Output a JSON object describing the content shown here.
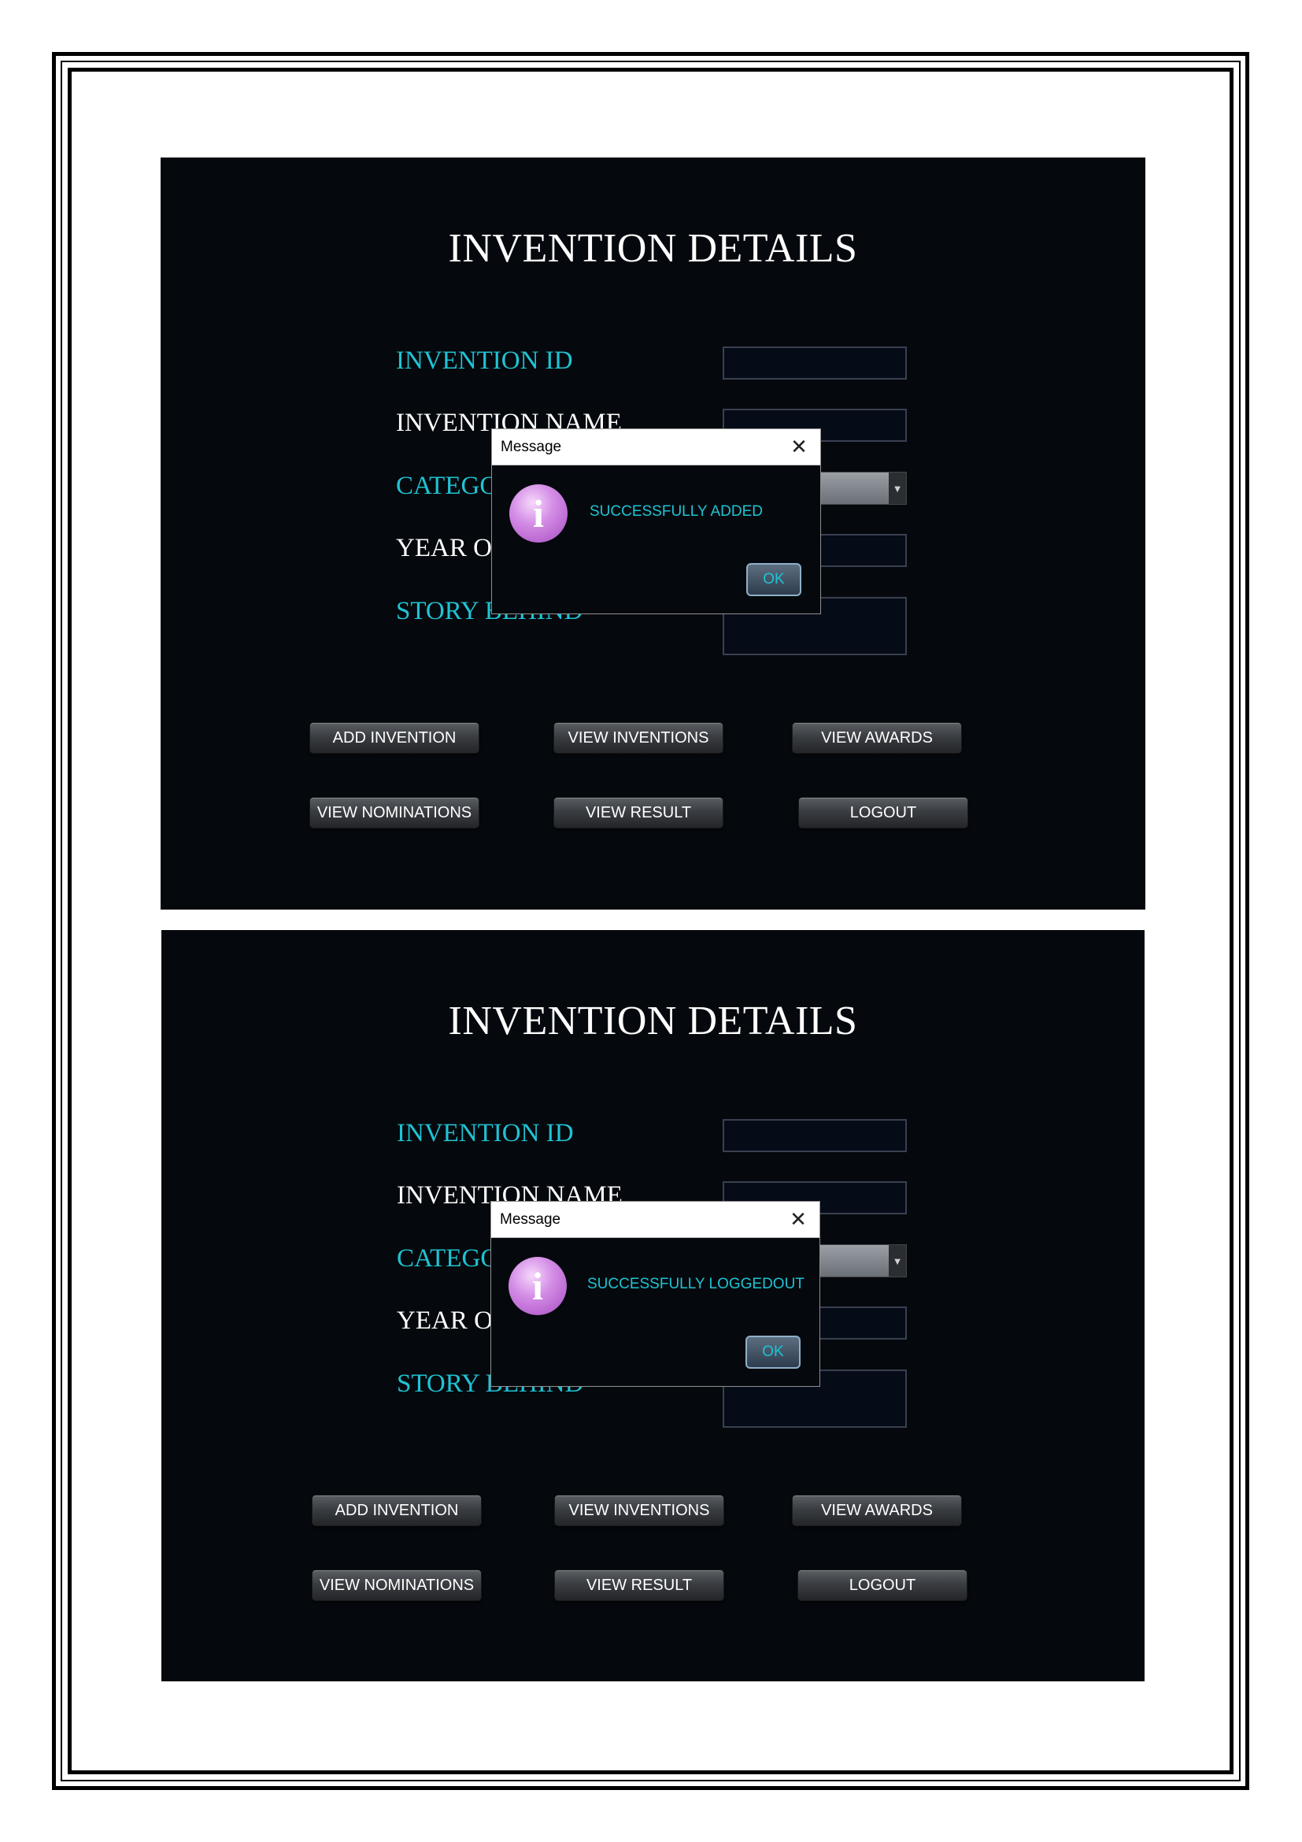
{
  "screens": [
    {
      "title": "INVENTION DETAILS",
      "labels": {
        "invention_id": "INVENTION ID",
        "invention_name": "INVENTION NAME",
        "category": "CATEGORY",
        "year": "YEAR OF",
        "story": "STORY BEHIND"
      },
      "buttons": {
        "add_invention": "ADD INVENTION",
        "view_inventions": "VIEW INVENTIONS",
        "view_awards": "VIEW AWARDS",
        "view_nominations": "VIEW NOMINATIONS",
        "view_result": "VIEW RESULT",
        "logout": "LOGOUT"
      },
      "dialog": {
        "title": "Message",
        "close_icon": "close-icon",
        "info_icon": "information-icon",
        "message": "SUCCESSFULLY ADDED",
        "ok_label": "OK"
      }
    },
    {
      "title": "INVENTION DETAILS",
      "labels": {
        "invention_id": "INVENTION ID",
        "invention_name": "INVENTION NAME",
        "category": "CATEGORY",
        "year": "YEAR OF",
        "story": "STORY BEHIND"
      },
      "buttons": {
        "add_invention": "ADD INVENTION",
        "view_inventions": "VIEW INVENTIONS",
        "view_awards": "VIEW AWARDS",
        "view_nominations": "VIEW NOMINATIONS",
        "view_result": "VIEW RESULT",
        "logout": "LOGOUT"
      },
      "dialog": {
        "title": "Message",
        "close_icon": "close-icon",
        "info_icon": "information-icon",
        "message": "SUCCESSFULLY LOGGEDOUT",
        "ok_label": "OK"
      }
    }
  ],
  "colors": {
    "background": "#05090d",
    "label_cyan": "#1fc3d4",
    "label_white": "#ffffff",
    "dialog_message": "#1fc3d4"
  }
}
